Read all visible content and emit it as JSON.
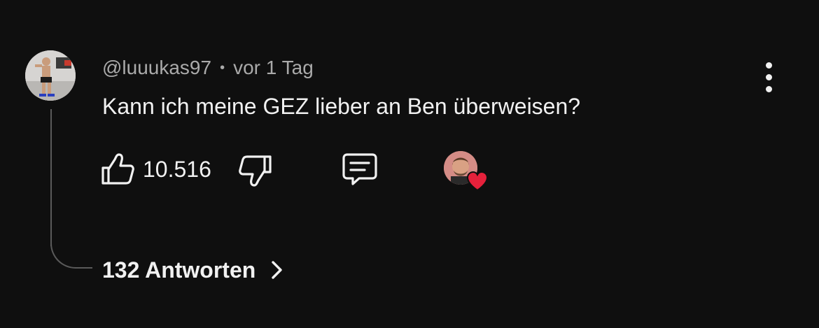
{
  "comment": {
    "author": "@luuukas97",
    "separator": "•",
    "time": "vor 1 Tag",
    "text": "Kann ich meine GEZ lieber an Ben überweisen?",
    "likes": "10.516",
    "replies_label": "132 Antworten"
  },
  "icons": {
    "author_avatar": "avatar-photo",
    "like": "thumb-up-icon",
    "dislike": "thumb-down-icon",
    "reply": "comment-icon",
    "creator_heart": "heart-icon",
    "more": "more-vertical-icon",
    "replies_chevron": "chevron-right-icon"
  },
  "colors": {
    "background": "#0f0f0f",
    "primary_text": "#f1f1f1",
    "secondary_text": "#aaaaaa",
    "heart": "#e5213b",
    "thread_line": "#5a5a5a"
  }
}
